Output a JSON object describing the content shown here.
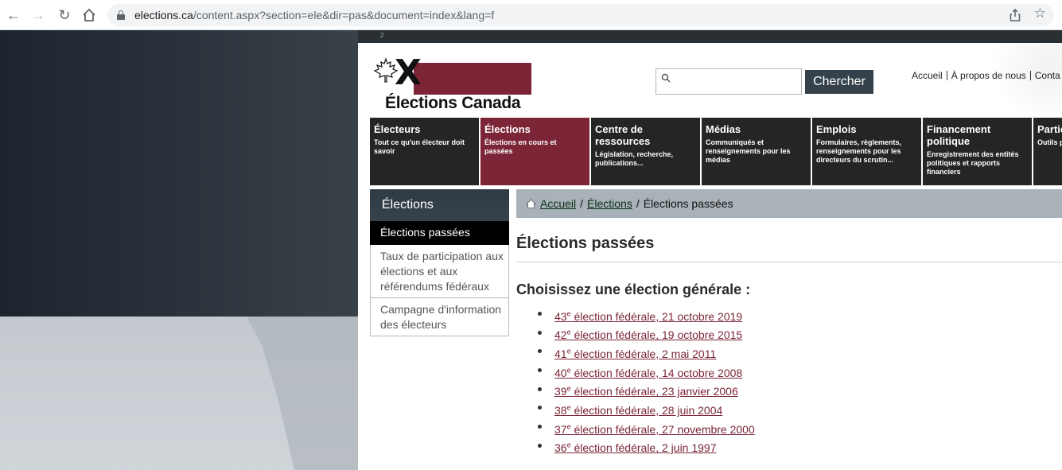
{
  "browser": {
    "url_host": "elections.ca",
    "url_path": "/content.aspx?section=ele&dir=pas&document=index&lang=f"
  },
  "page": {
    "strip_text": "2",
    "logo_text": "Élections Canada",
    "search": {
      "placeholder": "",
      "button_label": "Chercher"
    },
    "toplinks": [
      "Accueil",
      "À propos de nous",
      "Conta"
    ],
    "nav": [
      {
        "title": "Électeurs",
        "desc": "Tout ce qu'un électeur doit savoir"
      },
      {
        "title": "Élections",
        "desc": "Élections en cours et passées"
      },
      {
        "title": "Centre de ressources",
        "desc": "Législation, recherche, publications..."
      },
      {
        "title": "Médias",
        "desc": "Communiqués et renseignements pour les médias"
      },
      {
        "title": "Emplois",
        "desc": "Formulaires, règlements, renseignements pour les directeurs du scrutin..."
      },
      {
        "title": "Financement politique",
        "desc": "Enregistrement des entités politiques et rapports financiers"
      },
      {
        "title": "Partic politi",
        "desc": "Outils p candid circons"
      }
    ],
    "sidebar": {
      "heading": "Élections",
      "items": [
        "Élections passées",
        "Taux de participation aux élections et aux référendums fédéraux",
        "Campagne d'information des électeurs"
      ]
    },
    "breadcrumb": {
      "home": "Accueil",
      "section": "Élections",
      "current": "Élections passées"
    },
    "title": "Élections passées",
    "subhead": "Choisissez une élection générale :",
    "elections": [
      {
        "num": "43",
        "sup": "e",
        "text": " élection fédérale, 21 octobre 2019"
      },
      {
        "num": "42",
        "sup": "e",
        "text": " élection fédérale, 19 octobre 2015"
      },
      {
        "num": "41",
        "sup": "e",
        "text": " élection fédérale, 2 mai 2011"
      },
      {
        "num": "40",
        "sup": "e",
        "text": " élection fédérale, 14 octobre 2008"
      },
      {
        "num": "39",
        "sup": "e",
        "text": " élection fédérale, 23 janvier 2006"
      },
      {
        "num": "38",
        "sup": "e",
        "text": " élection fédérale, 28 juin 2004"
      },
      {
        "num": "37",
        "sup": "e",
        "text": " élection fédérale, 27 novembre 2000"
      },
      {
        "num": "36",
        "sup": "e",
        "text": " élection fédérale, 2 juin 1997"
      }
    ]
  }
}
